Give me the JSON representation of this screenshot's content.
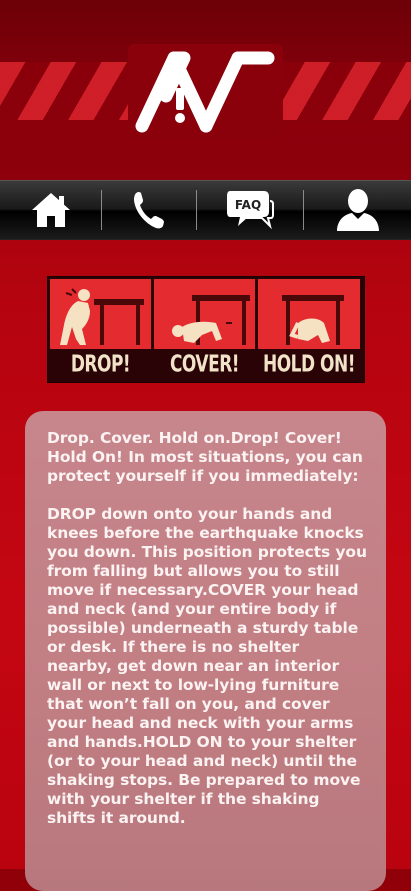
{
  "app": {
    "logo_letters": "AV!"
  },
  "navbar": {
    "items": [
      {
        "name": "home",
        "icon": "home-icon"
      },
      {
        "name": "call",
        "icon": "phone-icon"
      },
      {
        "name": "faq",
        "icon": "faq-icon",
        "label": "FAQ"
      },
      {
        "name": "profile",
        "icon": "user-icon"
      }
    ]
  },
  "banner": {
    "panels": [
      {
        "label": "DROP!"
      },
      {
        "label": "COVER!"
      },
      {
        "label": "HOLD ON!"
      }
    ]
  },
  "content": {
    "intro": "Drop. Cover. Hold on.Drop! Cover! Hold On! In most situations, you can protect yourself if you immediately:",
    "body": "DROP down onto your hands and knees before the earthquake knocks you down. This position protects you from falling but allows you to still move if necessary.COVER your head and neck (and your entire body if possible) underneath a sturdy table or desk. If there is no shelter nearby, get down near an interior wall or next to low-lying furniture that won’t fall on you, and cover your head and neck with your arms and hands.HOLD ON to your shelter (or to your head and neck) until the shaking stops. Be prepared to move with your shelter if the shaking shifts it around."
  },
  "colors": {
    "header_bg": "#8a000b",
    "stripe": "#d7222b",
    "background": "#c40612",
    "card": "#c2868b",
    "panel": "#e42b30",
    "navbar": "#1a1a1a"
  }
}
